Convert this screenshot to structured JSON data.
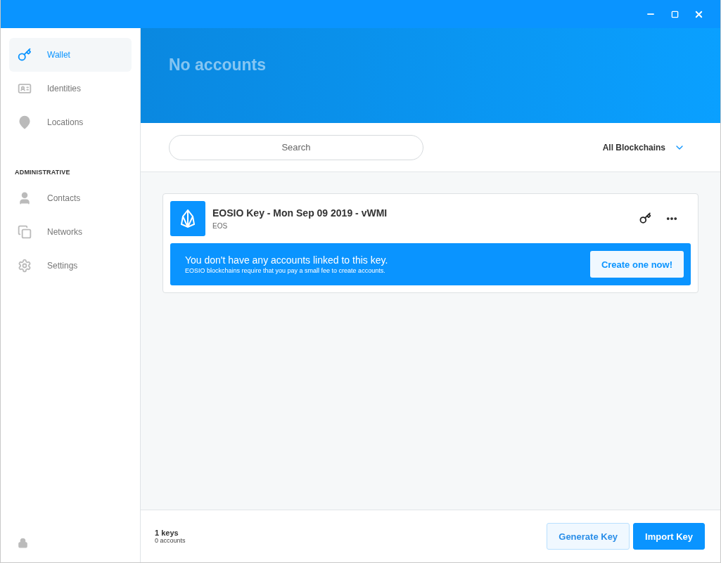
{
  "sidebar": {
    "items": [
      {
        "kind": "key",
        "label": "Wallet",
        "selected": true
      },
      {
        "kind": "id",
        "label": "Identities",
        "selected": false
      },
      {
        "kind": "pin",
        "label": "Locations",
        "selected": false
      }
    ],
    "section_title": "ADMINISTRATIVE",
    "admin_items": [
      {
        "kind": "user",
        "label": "Contacts",
        "selected": false
      },
      {
        "kind": "squares",
        "label": "Networks",
        "selected": false
      },
      {
        "kind": "gear",
        "label": "Settings",
        "selected": false
      }
    ]
  },
  "header": {
    "title": "No accounts"
  },
  "search": {
    "placeholder": "Search"
  },
  "filter": {
    "label": "All Blockchains"
  },
  "keys": [
    {
      "title": "EOSIO Key - Mon Sep 09 2019 - vWMI",
      "chain": "EOS",
      "notice": "You don't have any accounts linked to this key.",
      "notice_detail": "EOSIO blockchains require that you pay a small fee to create accounts.",
      "action": "Create one now!"
    }
  ],
  "footer": {
    "keys": "1 keys",
    "accounts": "0 accounts",
    "buttons": [
      {
        "label": "Generate Key",
        "kind": "secondary"
      },
      {
        "label": "Import Key",
        "kind": "primary"
      }
    ]
  }
}
